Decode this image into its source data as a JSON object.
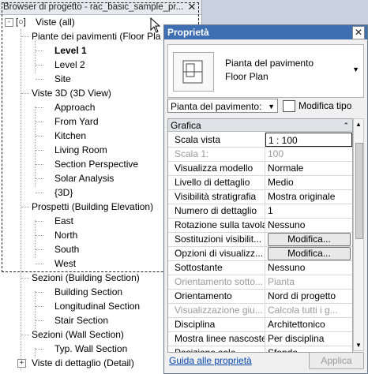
{
  "browser": {
    "title": "Browser di progetto - rac_basic_sample_pr...",
    "close": "✕",
    "tree": [
      {
        "label": "Viste (all)",
        "expander": "-"
      },
      {
        "label": "Piante dei pavimenti (Floor Pla",
        "expander": "-"
      },
      {
        "label": "Level 1",
        "bold": true
      },
      {
        "label": "Level 2"
      },
      {
        "label": "Site"
      },
      {
        "label": "Viste 3D (3D View)",
        "expander": "-"
      },
      {
        "label": "Approach"
      },
      {
        "label": "From Yard"
      },
      {
        "label": "Kitchen"
      },
      {
        "label": "Living Room"
      },
      {
        "label": "Section Perspective"
      },
      {
        "label": "Solar Analysis"
      },
      {
        "label": "{3D}"
      },
      {
        "label": "Prospetti (Building Elevation)",
        "expander": "-"
      },
      {
        "label": "East"
      },
      {
        "label": "North"
      },
      {
        "label": "South"
      },
      {
        "label": "West"
      },
      {
        "label": "Sezioni (Building Section)",
        "expander": "-"
      },
      {
        "label": "Building Section"
      },
      {
        "label": "Longitudinal Section"
      },
      {
        "label": "Stair Section"
      },
      {
        "label": "Sezioni (Wall Section)",
        "expander": "-"
      },
      {
        "label": "Typ. Wall Section"
      },
      {
        "label": "Viste di dettaglio (Detail)",
        "expander": "+"
      }
    ]
  },
  "properties": {
    "title": "Proprietà",
    "close": "✕",
    "type_name_1": "Pianta del pavimento",
    "type_name_2": "Floor Plan",
    "selector": "Pianta del pavimento:",
    "edit_type": "Modifica tipo",
    "group": "Grafica",
    "rows": [
      {
        "label": "Scala vista",
        "value": "1 : 100",
        "active": true
      },
      {
        "label": "Scala 1:",
        "value": "100",
        "grey": true
      },
      {
        "label": "Visualizza modello",
        "value": "Normale"
      },
      {
        "label": "Livello di dettaglio",
        "value": "Medio"
      },
      {
        "label": "Visibilità stratigrafia",
        "value": "Mostra originale"
      },
      {
        "label": "Numero di dettaglio",
        "value": "1"
      },
      {
        "label": "Rotazione sulla tavola",
        "value": "Nessuno"
      },
      {
        "label": "Sostituzioni visibilit...",
        "button": "Modifica..."
      },
      {
        "label": "Opzioni di visualizz...",
        "button": "Modifica..."
      },
      {
        "label": "Sottostante",
        "value": "Nessuno"
      },
      {
        "label": "Orientamento sotto...",
        "value": "Pianta",
        "grey": true
      },
      {
        "label": "Orientamento",
        "value": "Nord di progetto"
      },
      {
        "label": "Visualizzazione giu...",
        "value": "Calcola tutti i g...",
        "grey": true
      },
      {
        "label": "Disciplina",
        "value": "Architettonico"
      },
      {
        "label": "Mostra linee nascoste",
        "value": "Per disciplina"
      },
      {
        "label": "Posizione sole",
        "value": "Sfondo"
      }
    ],
    "help_link": "Guida alle proprietà",
    "apply": "Applica"
  }
}
